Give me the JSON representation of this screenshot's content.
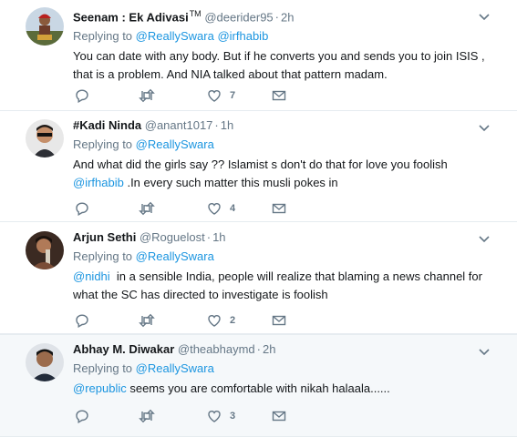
{
  "tweets": [
    {
      "fullname": "Seenam : Ek Adivasi",
      "tm": "TM",
      "handle": "@deerider95",
      "time": "2h",
      "replying_label": "Replying to",
      "replying_to": [
        "@ReallySwara",
        "@irfhabib"
      ],
      "text_lines": [
        "You can date with any body. But if he converts you and sends you to join ISIS ,",
        "that is a problem. And NIA talked about that pattern madam."
      ],
      "like_count": "7"
    },
    {
      "fullname": "#Kadi Ninda",
      "handle": "@anant1017",
      "time": "1h",
      "replying_label": "Replying to",
      "replying_to": [
        "@ReallySwara"
      ],
      "text_line1": "And what did the girls say ?? Islamist s don't do that for love you foolish",
      "text_line2_mention": "@irfhabib",
      "text_line2_rest": " .In every such matter this musli pokes in",
      "like_count": "4"
    },
    {
      "fullname": "Arjun Sethi",
      "handle": "@Roguelost",
      "time": "1h",
      "replying_label": "Replying to",
      "replying_to": [
        "@ReallySwara"
      ],
      "text_line1_mention": "@nidhi",
      "text_line1_rest": "  in a sensible India, people will realize that blaming a news channel for",
      "text_line2": "what the SC has directed to investigate is foolish",
      "like_count": "2"
    },
    {
      "fullname": "Abhay M. Diwakar",
      "handle": "@theabhaymd",
      "time": "2h",
      "replying_label": "Replying to",
      "replying_to": [
        "@ReallySwara"
      ],
      "text_mention": "@republic",
      "text_rest": " seems you are comfortable with nikah halaala......",
      "like_count": "3"
    }
  ],
  "icons": {
    "reply": "reply-icon",
    "retweet": "retweet-icon",
    "like": "heart-icon",
    "dm": "envelope-icon",
    "caret": "chevron-down-icon"
  },
  "colors": {
    "accent": "#1b95e0",
    "muted": "#657786",
    "text": "#14171a",
    "highlight_bg": "#f5f8fa"
  }
}
